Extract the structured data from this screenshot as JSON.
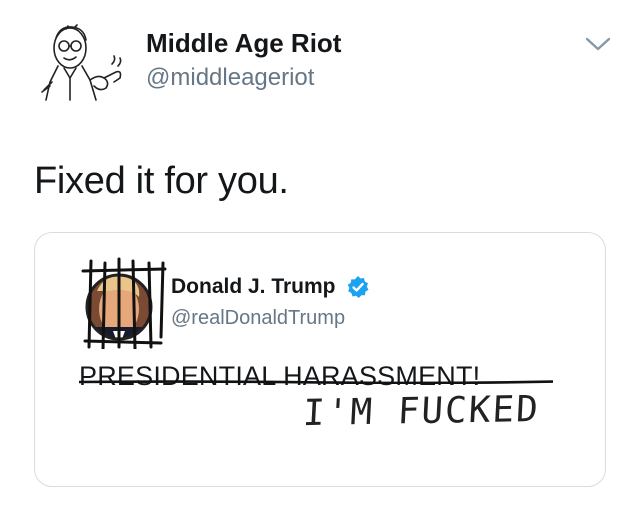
{
  "tweet": {
    "author": {
      "name": "Middle Age Riot",
      "handle": "@middleageriot",
      "avatar_icon": "vintage-man-pipe-illustration-icon"
    },
    "menu_icon": "chevron-down-icon",
    "text": "Fixed it for you."
  },
  "quoted_tweet": {
    "author": {
      "name": "Donald J. Trump",
      "handle": "@realDonaldTrump",
      "avatar_icon": "portrait-behind-bars-icon",
      "verified_icon": "verified-badge-icon",
      "verified_color": "#1da1f2"
    },
    "original_text": "PRESIDENTIAL HARASSMENT!",
    "handwritten_text": "I'M FUCKED"
  }
}
